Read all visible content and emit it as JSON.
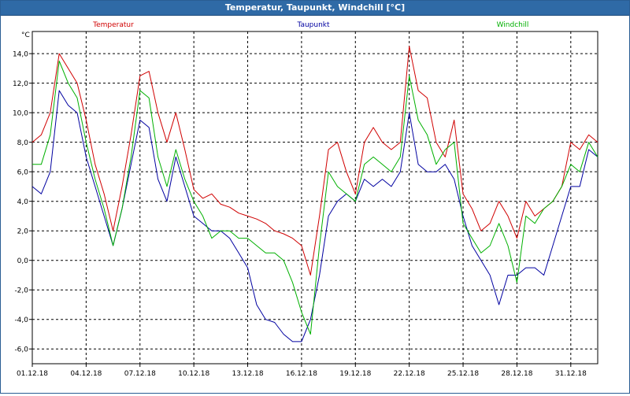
{
  "window": {
    "title": "Temperatur, Taupunkt, Windchill [°C]"
  },
  "chart_data": {
    "type": "line",
    "title": "Temperatur, Taupunkt, Windchill [°C]",
    "ylabel": "°C",
    "xlabel": "",
    "xlim": [
      0,
      31.5
    ],
    "ylim": [
      -7,
      15.5
    ],
    "x_ticks": [
      {
        "x": 0,
        "label": "01.12.18"
      },
      {
        "x": 3,
        "label": "04.12.18"
      },
      {
        "x": 6,
        "label": "07.12.18"
      },
      {
        "x": 9,
        "label": "10.12.18"
      },
      {
        "x": 12,
        "label": "13.12.18"
      },
      {
        "x": 15,
        "label": "16.12.18"
      },
      {
        "x": 18,
        "label": "19.12.18"
      },
      {
        "x": 21,
        "label": "22.12.18"
      },
      {
        "x": 24,
        "label": "25.12.18"
      },
      {
        "x": 27,
        "label": "28.12.18"
      },
      {
        "x": 30,
        "label": "31.12.18"
      }
    ],
    "y_ticks": [
      {
        "v": 14,
        "label": "14,0"
      },
      {
        "v": 12,
        "label": "12,0"
      },
      {
        "v": 10,
        "label": "10,0"
      },
      {
        "v": 8,
        "label": "8,0"
      },
      {
        "v": 6,
        "label": "6,0"
      },
      {
        "v": 4,
        "label": "4,0"
      },
      {
        "v": 2,
        "label": "2,0"
      },
      {
        "v": 0,
        "label": "0,0"
      },
      {
        "v": -2,
        "label": "-2,0"
      },
      {
        "v": -4,
        "label": "-4,0"
      },
      {
        "v": -6,
        "label": "-6,0"
      }
    ],
    "grid": true,
    "legend": "top",
    "series": [
      {
        "name": "Temperatur",
        "color": "#d00000",
        "x": [
          0,
          0.5,
          1,
          1.5,
          2,
          2.5,
          3,
          3.5,
          4,
          4.5,
          5,
          5.5,
          6,
          6.5,
          7,
          7.5,
          8,
          8.5,
          9,
          9.5,
          10,
          10.5,
          11,
          11.5,
          12,
          12.5,
          13,
          13.5,
          14,
          14.5,
          15,
          15.5,
          16,
          16.5,
          17,
          17.5,
          18,
          18.5,
          19,
          19.5,
          20,
          20.5,
          21,
          21.5,
          22,
          22.5,
          23,
          23.5,
          24,
          24.5,
          25,
          25.5,
          26,
          26.5,
          27,
          27.5,
          28,
          28.5,
          29,
          29.5,
          30,
          30.5,
          31,
          31.5
        ],
        "values": [
          8.0,
          8.5,
          10.0,
          14.0,
          13.0,
          12.0,
          9.5,
          6.5,
          4.5,
          2.0,
          5.0,
          8.5,
          12.5,
          12.8,
          10.0,
          8.0,
          10.0,
          7.5,
          4.8,
          4.2,
          4.5,
          3.8,
          3.6,
          3.2,
          3.0,
          2.8,
          2.5,
          2.0,
          1.8,
          1.5,
          1.0,
          -1.0,
          3.0,
          7.5,
          8.0,
          6.0,
          4.5,
          8.0,
          9.0,
          8.0,
          7.5,
          8.0,
          14.5,
          11.5,
          11.0,
          8.0,
          7.0,
          9.5,
          4.5,
          3.5,
          2.0,
          2.5,
          4.0,
          3.0,
          1.5,
          4.0,
          3.0,
          3.5,
          4.0,
          5.0,
          8.0,
          7.5,
          8.5,
          8.0
        ]
      },
      {
        "name": "Taupunkt",
        "color": "#0000a0",
        "x": [
          0,
          0.5,
          1,
          1.5,
          2,
          2.5,
          3,
          3.5,
          4,
          4.5,
          5,
          5.5,
          6,
          6.5,
          7,
          7.5,
          8,
          8.5,
          9,
          9.5,
          10,
          10.5,
          11,
          11.5,
          12,
          12.5,
          13,
          13.5,
          14,
          14.5,
          15,
          15.5,
          16,
          16.5,
          17,
          17.5,
          18,
          18.5,
          19,
          19.5,
          20,
          20.5,
          21,
          21.5,
          22,
          22.5,
          23,
          23.5,
          24,
          24.5,
          25,
          25.5,
          26,
          26.5,
          27,
          27.5,
          28,
          28.5,
          29,
          29.5,
          30,
          30.5,
          31,
          31.5
        ],
        "values": [
          5.0,
          4.5,
          6.0,
          11.5,
          10.5,
          10.0,
          7.0,
          5.0,
          3.0,
          1.0,
          3.5,
          6.5,
          9.5,
          9.0,
          5.5,
          4.0,
          7.0,
          5.0,
          3.0,
          2.5,
          2.0,
          2.0,
          1.5,
          0.5,
          -0.5,
          -3.0,
          -4.0,
          -4.2,
          -5.0,
          -5.5,
          -5.5,
          -4.0,
          -1.0,
          3.0,
          4.0,
          4.5,
          4.0,
          5.5,
          5.0,
          5.5,
          5.0,
          6.0,
          10.0,
          6.5,
          6.0,
          6.0,
          6.5,
          5.5,
          3.0,
          1.0,
          0.0,
          -1.0,
          -3.0,
          -1.0,
          -1.0,
          -0.5,
          -0.5,
          -1.0,
          1.0,
          3.0,
          5.0,
          5.0,
          7.5,
          7.0
        ]
      },
      {
        "name": "Windchill",
        "color": "#00b000",
        "x": [
          0,
          0.5,
          1,
          1.5,
          2,
          2.5,
          3,
          3.5,
          4,
          4.5,
          5,
          5.5,
          6,
          6.5,
          7,
          7.5,
          8,
          8.5,
          9,
          9.5,
          10,
          10.5,
          11,
          11.5,
          12,
          12.5,
          13,
          13.5,
          14,
          14.5,
          15,
          15.5,
          16,
          16.5,
          17,
          17.5,
          18,
          18.5,
          19,
          19.5,
          20,
          20.5,
          21,
          21.5,
          22,
          22.5,
          23,
          23.5,
          24,
          24.5,
          25,
          25.5,
          26,
          26.5,
          27,
          27.5,
          28,
          28.5,
          29,
          29.5,
          30,
          30.5,
          31,
          31.5
        ],
        "values": [
          6.5,
          6.5,
          8.5,
          13.5,
          12.0,
          11.0,
          8.0,
          5.5,
          3.5,
          1.0,
          3.5,
          7.0,
          11.5,
          11.0,
          7.0,
          5.0,
          7.5,
          5.5,
          4.0,
          3.0,
          1.5,
          2.0,
          2.0,
          1.5,
          1.5,
          1.0,
          0.5,
          0.5,
          0.0,
          -1.5,
          -3.5,
          -5.0,
          1.0,
          6.0,
          5.0,
          4.5,
          4.0,
          6.5,
          7.0,
          6.5,
          6.0,
          7.0,
          12.5,
          9.5,
          8.5,
          6.5,
          7.5,
          8.0,
          2.5,
          1.5,
          0.5,
          1.0,
          2.5,
          1.0,
          -1.5,
          3.0,
          2.5,
          3.5,
          4.0,
          5.0,
          6.5,
          6.0,
          8.0,
          7.0
        ]
      }
    ]
  }
}
